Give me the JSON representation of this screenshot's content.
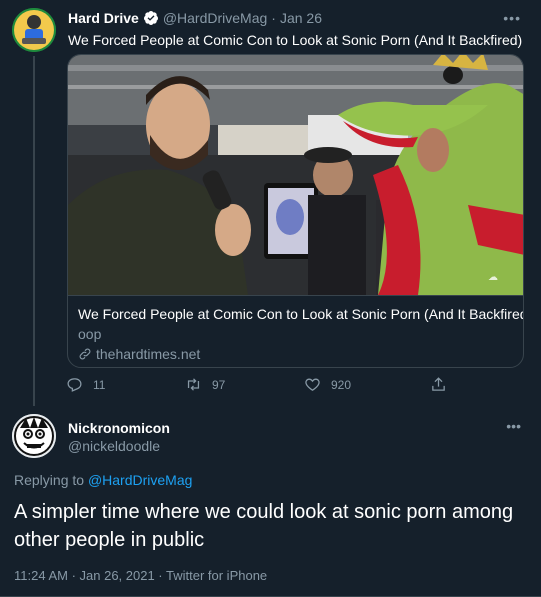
{
  "tweet": {
    "author_name": "Hard Drive",
    "author_handle": "@HardDriveMag",
    "separator": "·",
    "date": "Jan 26",
    "text": "We Forced People at Comic Con to Look at Sonic Porn (And It Backfired)",
    "card": {
      "title": "We Forced People at Comic Con to Look at Sonic Porn (And It Backfired)",
      "description": "oop",
      "domain": "thehardtimes.net"
    },
    "actions": {
      "replies": "11",
      "retweets": "97",
      "likes": "920"
    }
  },
  "reply": {
    "author_name": "Nickronomicon",
    "author_handle": "@nickeldoodle",
    "replying_to_prefix": "Replying to",
    "replying_to_handle": "@HardDriveMag",
    "text": "A simpler time where we could look at sonic porn among other people in public",
    "meta": "11:24 AM · Jan 26, 2021 · Twitter for iPhone"
  },
  "icons": {
    "more": "more-icon",
    "verified": "verified-badge-icon",
    "link": "link-icon",
    "reply": "reply-icon",
    "retweet": "retweet-icon",
    "like": "like-icon",
    "share": "share-icon"
  },
  "colors": {
    "background": "#15202b",
    "accent": "#1da1f2",
    "muted": "#8899a6",
    "border": "#38444d"
  }
}
